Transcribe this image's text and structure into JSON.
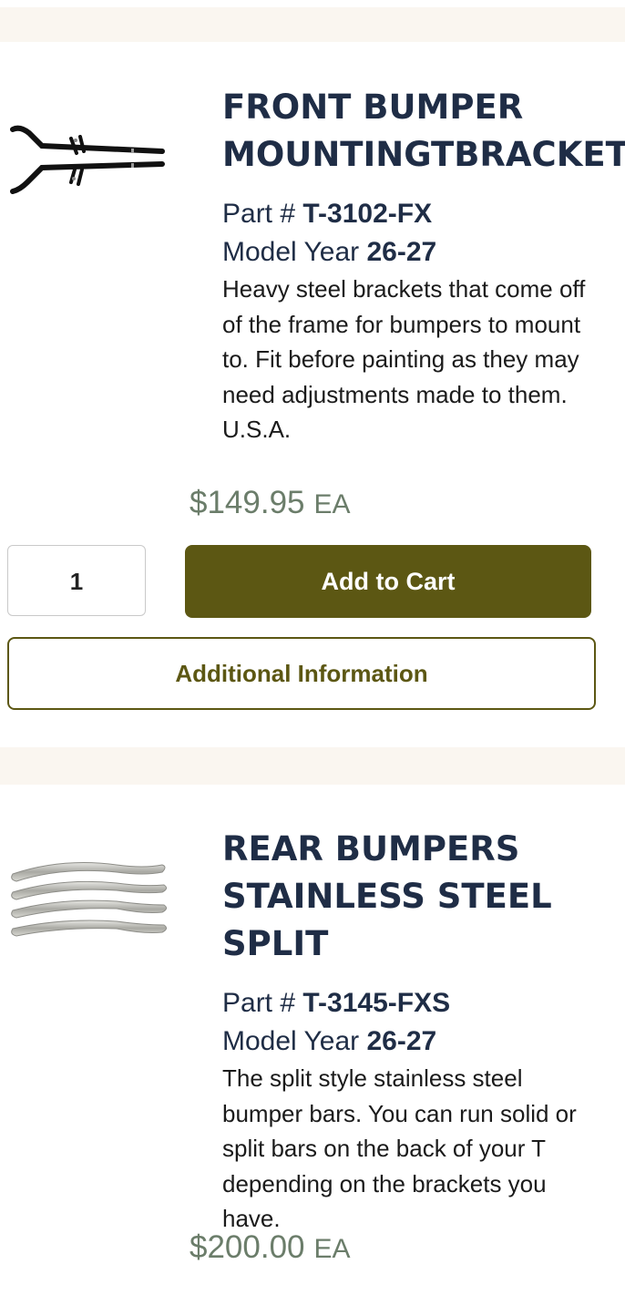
{
  "products": [
    {
      "title_line1": "FRONT BUMPER",
      "title_line2": "MOUNTINGTBRACKET",
      "part_label": "Part #",
      "part_number": "T-3102-FX",
      "year_label": "Model Year",
      "model_year": "26-27",
      "description": "Heavy steel brackets that come off of the frame for bumpers to mount to. Fit before painting as they may need adjustments made to them. U.S.A.",
      "price": "$149.95",
      "unit": "EA",
      "quantity": "1",
      "add_to_cart_label": "Add to Cart",
      "additional_info_label": "Additional Information",
      "image_icon": "bumper-bracket-image"
    },
    {
      "title_line1": "REAR BUMPERS",
      "title_line2": "STAINLESS STEEL",
      "title_line3": "SPLIT",
      "part_label": "Part #",
      "part_number": "T-3145-FXS",
      "year_label": "Model Year",
      "model_year": "26-27",
      "description": "The split style stainless steel bumper bars. You can run solid or split bars on the back of your T depending on the brackets you have.",
      "price": "$200.00",
      "unit": "EA",
      "image_icon": "stainless-bumper-bars-image"
    }
  ],
  "colors": {
    "title": "#1f2d46",
    "price": "#6b7d6a",
    "accent": "#5c5713",
    "background": "#faf6f0"
  }
}
